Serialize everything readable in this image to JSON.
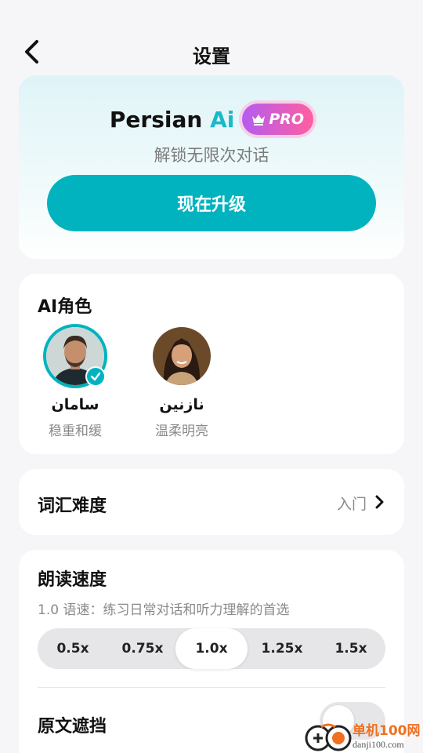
{
  "header": {
    "title": "设置",
    "back_icon": "chevron-left-icon"
  },
  "pro": {
    "brand_main": "Persian ",
    "brand_accent": "Ai",
    "badge_label": "PRO",
    "subtitle": "解锁无限次对话",
    "upgrade_label": "现在升级",
    "colors": {
      "accent": "#00b3bf",
      "badge_start": "#b45cf0",
      "badge_end": "#ff5fa0"
    }
  },
  "roles": {
    "title": "AI角色",
    "items": [
      {
        "name": "سامان",
        "description": "稳重和缓",
        "selected": true
      },
      {
        "name": "نازنین",
        "description": "温柔明亮",
        "selected": false
      }
    ]
  },
  "vocab": {
    "label": "词汇难度",
    "value": "入门"
  },
  "speed": {
    "title": "朗读速度",
    "description": "1.0 语速：练习日常对话和听力理解的首选",
    "options": [
      "0.5x",
      "0.75x",
      "1.0x",
      "1.25x",
      "1.5x"
    ],
    "selected": "1.0x"
  },
  "cover": {
    "label": "原文遮挡",
    "enabled": false
  },
  "watermark": {
    "text": "单机100网",
    "url": "danji100.com"
  }
}
